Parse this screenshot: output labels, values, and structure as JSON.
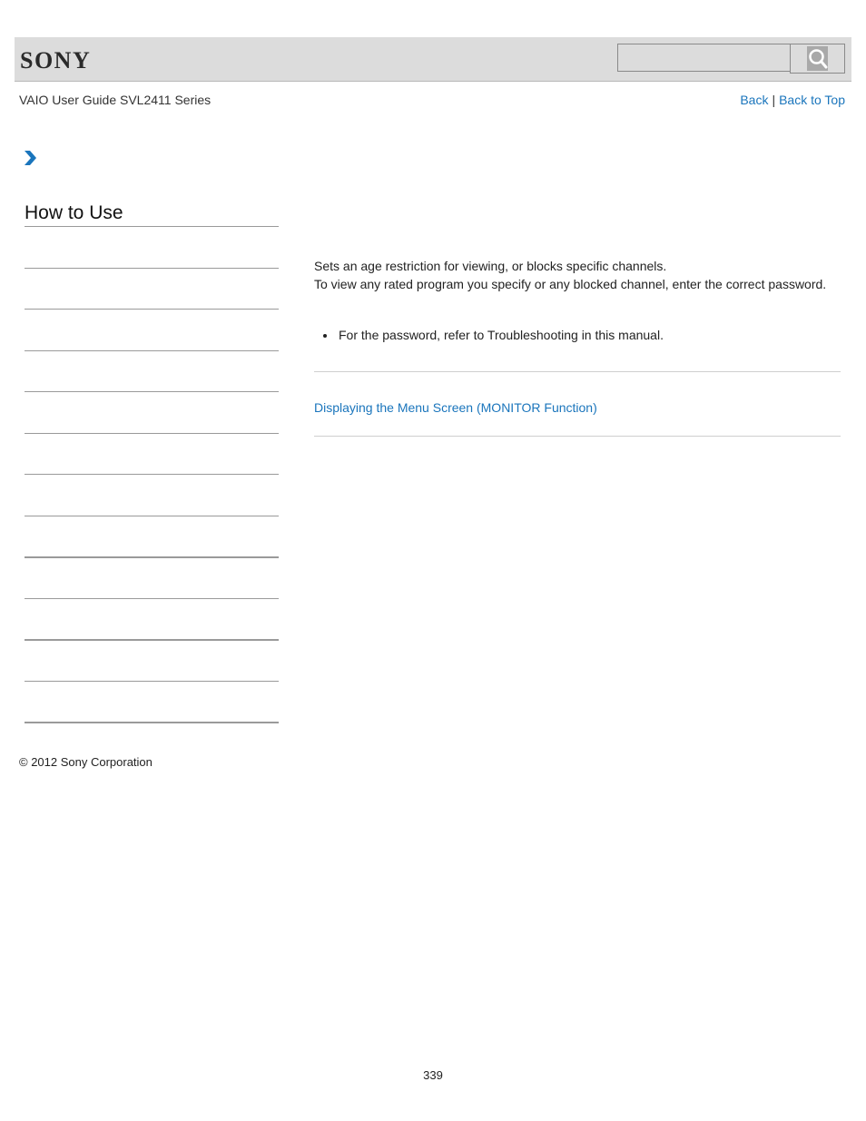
{
  "header": {
    "brand": "SONY",
    "search_placeholder": "",
    "search_value": "",
    "search_icon": "magnifier-icon"
  },
  "subheader": {
    "guide_title": "VAIO User Guide SVL2411 Series",
    "back_label": "Back",
    "separator": "|",
    "back_to_top_label": "Back to Top"
  },
  "breadcrumb": {
    "icon": "chevron-right-icon",
    "accent_color": "#1a75bc"
  },
  "sidebar": {
    "title": "How to Use",
    "item_count": 12
  },
  "main": {
    "paragraphs": [
      "Sets an age restriction for viewing, or blocks specific channels.",
      "To view any rated program you specify or any blocked channel, enter the correct password."
    ],
    "notes": [
      "For the password, refer to Troubleshooting in this manual."
    ],
    "related_links": [
      "Displaying the Menu Screen (MONITOR Function)"
    ]
  },
  "footer": {
    "copyright": "© 2012 Sony Corporation",
    "page_number": "339"
  },
  "colors": {
    "link": "#1a75bc",
    "header_bg": "#dcdcdc"
  }
}
